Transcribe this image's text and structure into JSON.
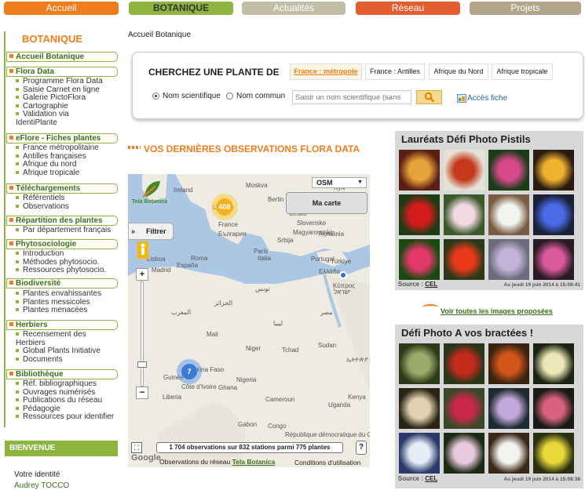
{
  "nav": {
    "tabs": [
      {
        "label": "Accueil",
        "color": "#f07d1b"
      },
      {
        "label": "BOTANIQUE",
        "color": "#8db43e",
        "active": true
      },
      {
        "label": "Actualités",
        "color": "#c3bfa7"
      },
      {
        "label": "Réseau",
        "color": "#e45d31"
      },
      {
        "label": "Projets",
        "color": "#b3a58c"
      }
    ]
  },
  "sidebar": {
    "title": "BOTANIQUE",
    "sections": [
      {
        "label": "Accueil Botanique",
        "items": []
      },
      {
        "label": "Flora Data",
        "items": [
          "Programme Flora Data",
          "Saisie Carnet en ligne",
          "Galerie PictoFlora",
          "Cartographie",
          "Validation via",
          "IdentiPlante"
        ]
      },
      {
        "label": "eFlore - Fiches plantes",
        "items": [
          "France métropolitaine",
          "Antilles françaises",
          "Afrique du nord",
          "Afrique tropicale"
        ]
      },
      {
        "label": "Téléchargements",
        "items": [
          "Référentiels",
          "Observations"
        ]
      },
      {
        "label": "Répartition des plantes",
        "items": [
          "Par département français"
        ]
      },
      {
        "label": "Phytosociologie",
        "items": [
          "Introduction",
          "Méthodes phytosocio.",
          "Ressources phytosocio."
        ]
      },
      {
        "label": "Biodiversité",
        "items": [
          "Plantes envahissantes",
          "Plantes messicoles",
          "Plantes menacées"
        ]
      },
      {
        "label": "Herbiers",
        "items": [
          "Recensement des",
          "Herbiers",
          "Global Plants Initiative",
          "Documents"
        ]
      },
      {
        "label": "Bibliothèque",
        "items": [
          "Réf. bibliographiques",
          "Ouvrages numérisés",
          "Publications du réseau",
          "Pédagogie",
          "Ressources pour identifier"
        ]
      }
    ],
    "bienvenue": "BIENVENUE",
    "identity": "Votre identité",
    "user": "Audrey TOCCO"
  },
  "breadcrumb": "Accueil Botanique",
  "search": {
    "title": "CHERCHEZ UNE PLANTE DE",
    "tabs": [
      "France : métropole",
      "France : Antilles",
      "Afrique du Nord",
      "Afrique tropicale"
    ],
    "radio1": "Nom scientifique",
    "radio2": "Nom commun",
    "placeholder": "Saisir un nom scientifique (sans",
    "access": "Accès fiche"
  },
  "observations": {
    "title": "VOS DERNIÈRES OBSERVATIONS FLORA DATA",
    "layer": "OSM",
    "mymap": "Ma carte",
    "filter": "Filtrer",
    "logo": "Tela Botanica",
    "cluster1": "408",
    "cluster2": "7",
    "stats": "1 704 observations sur 832 stations parmi 775 plantes",
    "footer_prefix": "Observations du réseau",
    "footer_link": "Tela Botanica",
    "conditions": "Conditions d'utilisation",
    "google": "Google",
    "help": "?",
    "labels": [
      "Ireland",
      "London",
      "Berlin",
      "Kyiv",
      "Česko",
      "Slovensko",
      "Magyarország",
      "România",
      "Srbija",
      "България",
      "France",
      "Paris",
      "Italia",
      "Roma",
      "España",
      "Madrid",
      "Lisboa",
      "Portugal",
      "Ελλάδα",
      "Türkiye",
      "Κύπρος",
      "ישראל",
      "الجزائر",
      "تونس",
      "المغرب",
      "ليبيا",
      "مصر",
      "Mali",
      "Niger",
      "Tchad",
      "Sudan",
      "Nigeria",
      "Cameroun",
      "Burkina Faso",
      "Côte d'Ivoire",
      "Ghana",
      "Liberia",
      "Guinée",
      "Congo",
      "Gabon",
      "République démocratique du Congo",
      "ኢትዮጵያ",
      "Kenya",
      "Uganda",
      "Moskva"
    ]
  },
  "photos1": {
    "title": "Lauréats Défi Photo Pistils",
    "source": "Source :",
    "cel": "CEL",
    "date": "Au jeudi 19 juin 2014 à 15:08:41"
  },
  "voir": "Voir toutes les images proposées",
  "photos2": {
    "title": "Défi Photo A vos bractées !",
    "source": "Source :",
    "cel": "CEL",
    "date": "Au jeudi 19 juin 2014 à 15:08:38"
  }
}
